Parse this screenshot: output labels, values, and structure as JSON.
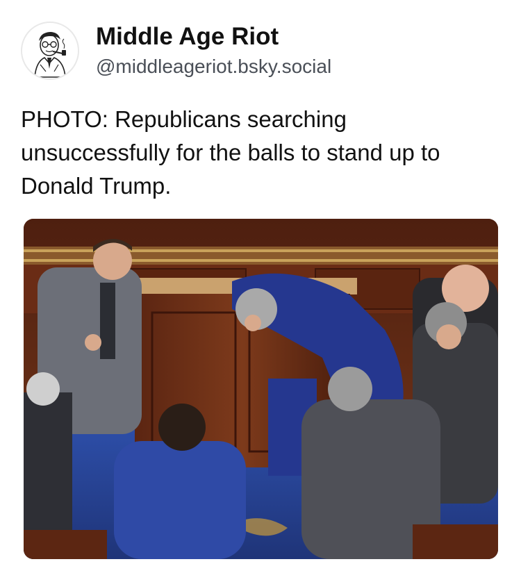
{
  "post": {
    "author": {
      "display_name": "Middle Age Riot",
      "handle": "@middleageriot.bsky.social",
      "avatar_icon": "vintage-man-pipe-avatar"
    },
    "text": "PHOTO: Republicans searching unsuccessfully for the balls to stand up to Donald Trump.",
    "media": {
      "kind": "photo",
      "subject_icon": "legislators-kneeling-at-podium-photo"
    }
  },
  "colors": {
    "text_primary": "#111111",
    "text_secondary": "#4a4f57",
    "background": "#ffffff",
    "wood": "#6b2f18",
    "carpet_blue": "#2a47a0"
  }
}
